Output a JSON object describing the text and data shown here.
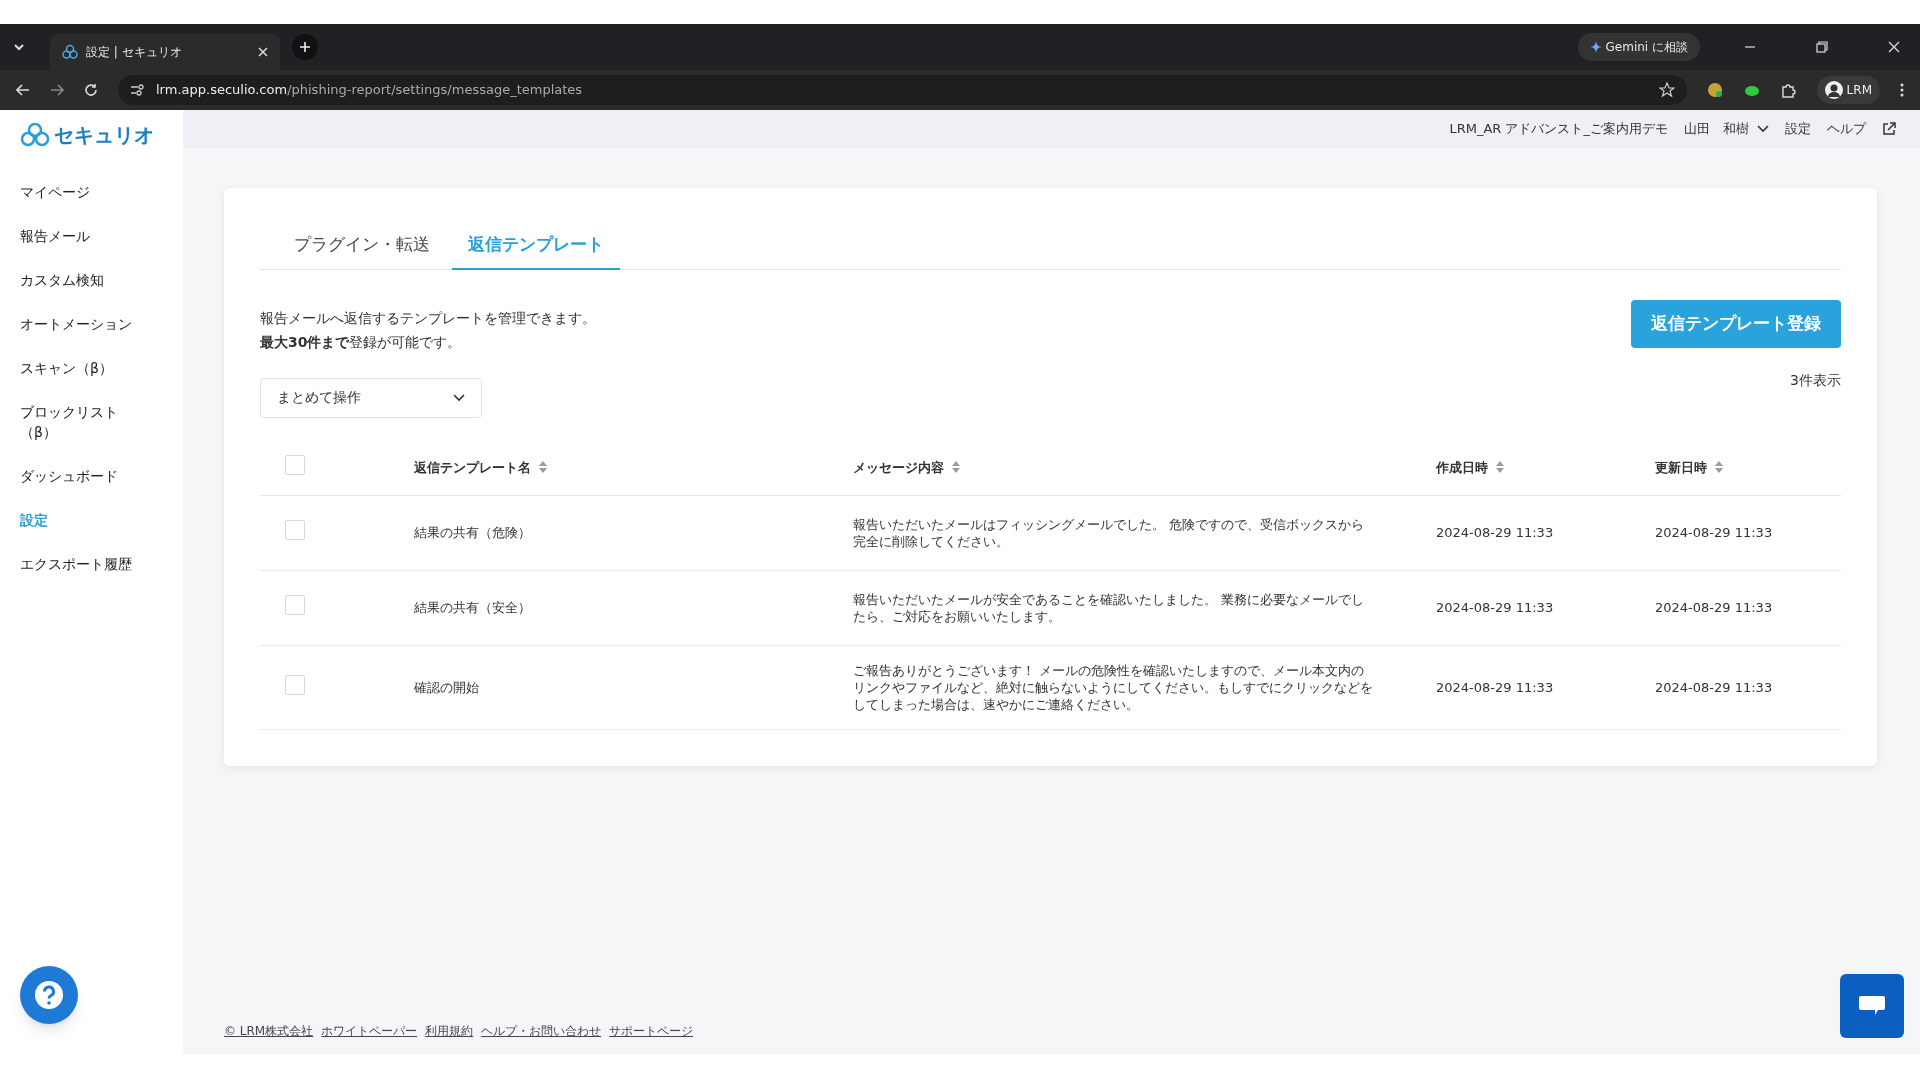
{
  "browser": {
    "tab_title": "設定 | セキュリオ",
    "url_host": "lrm.app.seculio.com",
    "url_path": "/phishing-report/settings/message_templates",
    "gemini_button": "Gemini に相談",
    "profile": "LRM"
  },
  "sidebar": {
    "logo": "セキュリオ",
    "items": [
      {
        "label": "マイページ",
        "selected": false
      },
      {
        "label": "報告メール",
        "selected": false
      },
      {
        "label": "カスタム検知",
        "selected": false
      },
      {
        "label": "オートメーション",
        "selected": false
      },
      {
        "label": "スキャン（β）",
        "selected": false
      },
      {
        "label": "ブロックリスト（β）",
        "selected": false
      },
      {
        "label": "ダッシュボード",
        "selected": false
      },
      {
        "label": "設定",
        "selected": true
      },
      {
        "label": "エクスポート履歴",
        "selected": false
      }
    ]
  },
  "header": {
    "organization": "LRM_AR アドバンスト_ご案内用デモ",
    "user": "山田　和樹",
    "links": [
      "設定",
      "ヘルプ"
    ]
  },
  "tabs": [
    {
      "label": "プラグイン・転送",
      "selected": false
    },
    {
      "label": "返信テンプレート",
      "selected": true
    }
  ],
  "description": [
    "報告メールへ返信するテンプレートを管理できます。",
    "**最大30件まで**登録が可能です。"
  ],
  "register_button": "返信テンプレート登録",
  "bulk_action": "まとめて操作",
  "count": "3件表示",
  "table": {
    "columns": [
      "返信テンプレート名",
      "メッセージ内容",
      "作成日時",
      "更新日時"
    ],
    "header_checked": false,
    "rows": [
      {
        "checked": false,
        "name": "結果の共有（危険）",
        "message": "報告いただいたメールはフィッシングメールでした。 危険ですので、受信ボックスから完全に削除してください。",
        "created": "2024-08-29 11:33",
        "updated": "2024-08-29 11:33"
      },
      {
        "checked": false,
        "name": "結果の共有（安全）",
        "message": "報告いただいたメールが安全であることを確認いたしました。 業務に必要なメールでしたら、ご対応をお願いいたします。",
        "created": "2024-08-29 11:33",
        "updated": "2024-08-29 11:33"
      },
      {
        "checked": false,
        "name": "確認の開始",
        "message": "ご報告ありがとうございます！ メールの危険性を確認いたしますので、メール本文内のリンクやファイルなど、絶対に触らないようにしてください。もしすでにクリックなどをしてしまった場合は、速やかにご連絡ください。",
        "created": "2024-08-29 11:33",
        "updated": "2024-08-29 11:33"
      }
    ]
  },
  "footer": {
    "copyright": "© LRM株式会社",
    "links": [
      "ホワイトペーパー",
      "利用規約",
      "ヘルプ・お問い合わせ",
      "サポートページ"
    ]
  }
}
